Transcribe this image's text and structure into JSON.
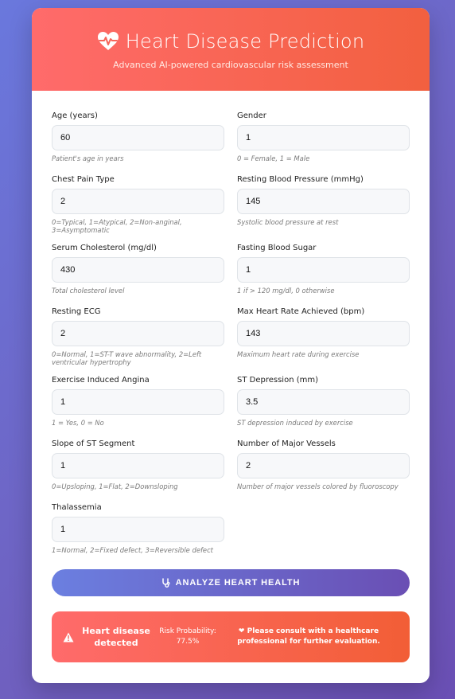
{
  "header": {
    "title": "Heart Disease Prediction",
    "subtitle": "Advanced AI-powered cardiovascular risk assessment"
  },
  "fields": [
    {
      "label": "Age (years)",
      "value": "60",
      "help": "Patient's age in years"
    },
    {
      "label": "Gender",
      "value": "1",
      "help": "0 = Female, 1 = Male"
    },
    {
      "label": "Chest Pain Type",
      "value": "2",
      "help": "0=Typical, 1=Atypical, 2=Non-anginal, 3=Asymptomatic"
    },
    {
      "label": "Resting Blood Pressure (mmHg)",
      "value": "145",
      "help": "Systolic blood pressure at rest"
    },
    {
      "label": "Serum Cholesterol (mg/dl)",
      "value": "430",
      "help": "Total cholesterol level"
    },
    {
      "label": "Fasting Blood Sugar",
      "value": "1",
      "help": "1 if > 120 mg/dl, 0 otherwise"
    },
    {
      "label": "Resting ECG",
      "value": "2",
      "help": "0=Normal, 1=ST-T wave abnormality, 2=Left ventricular hypertrophy"
    },
    {
      "label": "Max Heart Rate Achieved (bpm)",
      "value": "143",
      "help": "Maximum heart rate during exercise"
    },
    {
      "label": "Exercise Induced Angina",
      "value": "1",
      "help": "1 = Yes, 0 = No"
    },
    {
      "label": "ST Depression (mm)",
      "value": "3.5",
      "help": "ST depression induced by exercise"
    },
    {
      "label": "Slope of ST Segment",
      "value": "1",
      "help": "0=Upsloping, 1=Flat, 2=Downsloping"
    },
    {
      "label": "Number of Major Vessels",
      "value": "2",
      "help": "Number of major vessels colored by fluoroscopy"
    },
    {
      "label": "Thalassemia",
      "value": "1",
      "help": "1=Normal, 2=Fixed defect, 3=Reversible defect"
    }
  ],
  "analyze_button": {
    "label": "ANALYZE HEART HEALTH"
  },
  "result": {
    "title": "Heart disease detected",
    "probability_label": "Risk Probability:",
    "probability_value": "77.5%",
    "advice": "Please consult with a healthcare professional for further evaluation."
  },
  "colors": {
    "header_start": "#ff6b6b",
    "header_end": "#f2603f",
    "button_start": "#6b7fe0",
    "button_end": "#6a4fb4"
  },
  "icons": {
    "title": "heart-pulse-icon",
    "button": "stethoscope-icon",
    "result": "warning-icon",
    "advice": "heart-icon"
  }
}
